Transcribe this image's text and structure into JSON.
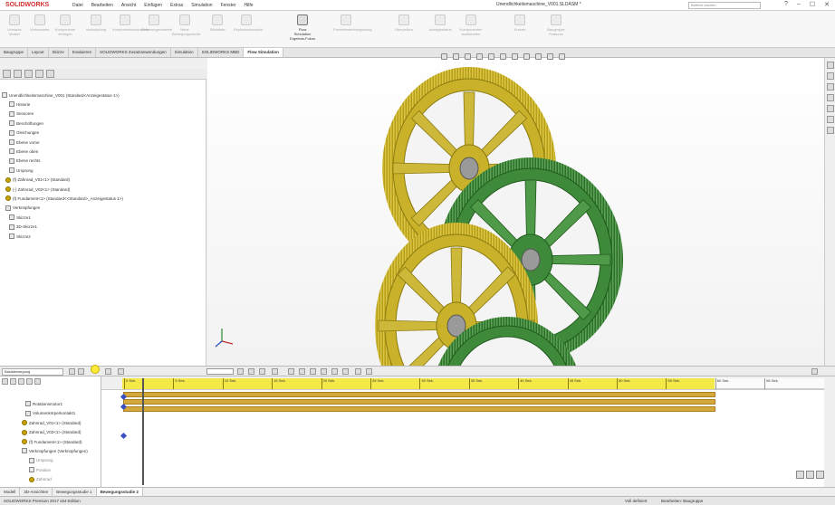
{
  "app": {
    "logo": "SOLIDWORKS",
    "document_title": "Unendlichkeitsmaschine_V001.SLDASM *",
    "search_placeholder": "Befehle suchen",
    "window_buttons": [
      "?",
      "–",
      "☐",
      "✕"
    ]
  },
  "menu": [
    "Datei",
    "Bearbeiten",
    "Ansicht",
    "Einfügen",
    "Extras",
    "Simulation",
    "Fenster",
    "Hilfe"
  ],
  "ribbon": [
    {
      "label": "Lineares Muster",
      "active": false
    },
    {
      "label": "Kreismuster",
      "active": false
    },
    {
      "label": "Komponente einfügen",
      "active": false
    },
    {
      "label": "Verknüpfung",
      "active": false
    },
    {
      "label": "Komponentenvorschau",
      "active": false
    },
    {
      "label": "Referenzgeometrie",
      "active": false
    },
    {
      "label": "Neue Bewegungsstudie",
      "active": false
    },
    {
      "label": "Stückliste",
      "active": false
    },
    {
      "label": "Explosionsansicht",
      "active": false
    },
    {
      "label": "Flow Simulation Ergebnis-Fokus",
      "active": true
    },
    {
      "label": "Formelementumgebung",
      "active": false
    },
    {
      "label": "Überprüfen",
      "active": false
    },
    {
      "label": "Anzeigestatus",
      "active": false
    },
    {
      "label": "Komponenten ausblenden",
      "active": false
    },
    {
      "label": "Kurven",
      "active": false
    },
    {
      "label": "Baugruppe Features",
      "active": false
    }
  ],
  "tabs": [
    {
      "label": "Baugruppe",
      "active": false
    },
    {
      "label": "Layout",
      "active": false
    },
    {
      "label": "Skizze",
      "active": false
    },
    {
      "label": "Evaluieren",
      "active": false
    },
    {
      "label": "SOLIDWORKS Zusatzanwendungen",
      "active": false
    },
    {
      "label": "Simulation",
      "active": false
    },
    {
      "label": "SOLIDWORKS MBD",
      "active": false
    },
    {
      "label": "Flow Simulation",
      "active": true
    }
  ],
  "feature_tree": [
    {
      "label": "Unendlichkeitsmaschine_V001 (Standard<Anzeigestatus-1>)",
      "icon": "assembly-icon"
    },
    {
      "label": "Historie",
      "icon": "history-icon"
    },
    {
      "label": "Sensoren",
      "icon": "sensor-icon"
    },
    {
      "label": "Beschriftungen",
      "icon": "annotation-icon"
    },
    {
      "label": "Gleichungen",
      "icon": "equation-icon"
    },
    {
      "label": "Ebene vorne",
      "icon": "plane-icon"
    },
    {
      "label": "Ebene oben",
      "icon": "plane-icon"
    },
    {
      "label": "Ebene rechts",
      "icon": "plane-icon"
    },
    {
      "label": "Ursprung",
      "icon": "origin-icon"
    },
    {
      "label": "(f) Zahnrad_V01<1> (Standard)",
      "icon": "gear-icon"
    },
    {
      "label": "(-) Zahnrad_V02<1> (Standard)",
      "icon": "gear-icon"
    },
    {
      "label": "(f) Fundament<1> (Standard<<Standard>_Anzeigestatus 1>)",
      "icon": "gear-icon"
    },
    {
      "label": "Verknüpfungen",
      "icon": "mates-icon"
    },
    {
      "label": "Skizze1",
      "icon": "sketch-icon"
    },
    {
      "label": "3D-Skizze1",
      "icon": "sketch-icon"
    },
    {
      "label": "Skizze2",
      "icon": "sketch-icon"
    }
  ],
  "motion": {
    "study_type": "Basisbewegung",
    "tree": [
      {
        "label": "Unendlichkeitsmaschine_V001",
        "icon": "assembly-icon"
      },
      {
        "label": "Rotationsmotor1",
        "icon": "motor-icon"
      },
      {
        "label": "Volumenkörperkontakt1",
        "icon": "contact-icon"
      },
      {
        "label": "Zahnrad_V01<1> (Standard)",
        "icon": "gear-icon"
      },
      {
        "label": "Zahnrad_V02<1> (Standard)",
        "icon": "gear-icon"
      },
      {
        "label": "(f) Fundament<1> (Standard)",
        "icon": "gear-icon"
      },
      {
        "label": "Verknüpfungen (Verknüpfungen)",
        "icon": "mates-icon"
      },
      {
        "label": "Ursprung",
        "icon": "origin-icon"
      },
      {
        "label": "Position",
        "icon": "position-icon"
      },
      {
        "label": "Zahnrad",
        "icon": "gear-icon"
      }
    ],
    "ticks": [
      "0 Sek.",
      "5 Sek.",
      "10 Sek.",
      "15 Sek.",
      "20 Sek.",
      "25 Sek.",
      "30 Sek.",
      "35 Sek.",
      "40 Sek.",
      "45 Sek.",
      "50 Sek.",
      "55 Sek.",
      "60 Sek.",
      "65 Sek."
    ]
  },
  "bottom_tabs": [
    {
      "label": "Modell",
      "active": false
    },
    {
      "label": "3D-Ansichten",
      "active": false
    },
    {
      "label": "Bewegungsstudie 1",
      "active": false
    },
    {
      "label": "Bewegungsstudie 2",
      "active": true
    }
  ],
  "status": {
    "left": "SOLIDWORKS Premium 2017 x64-Edition",
    "mid": "Voll definiert",
    "right": "Bearbeiten: Baugruppe"
  },
  "colors": {
    "gear_yellow": "#c9b22a",
    "gear_green": "#3f8a3a",
    "timeline_yellow": "#f5e94a",
    "bar_gold": "#d4a83a"
  }
}
